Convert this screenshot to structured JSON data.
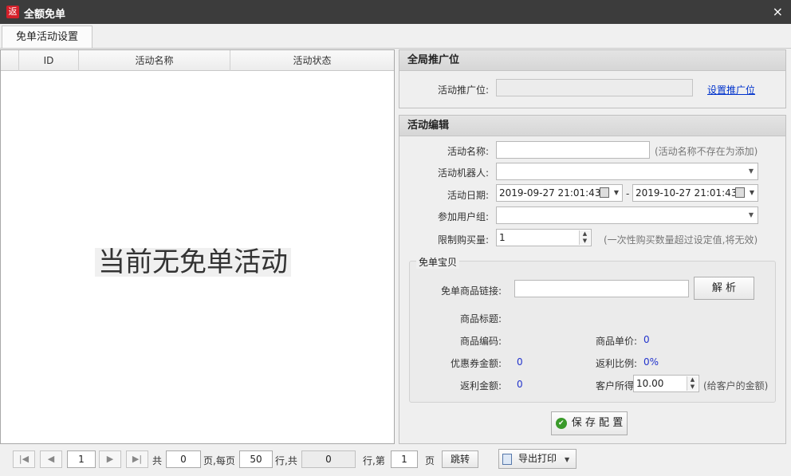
{
  "window": {
    "icon_text": "返",
    "title": "全额免单",
    "close": "×"
  },
  "tab": {
    "label": "免单活动设置"
  },
  "grid": {
    "columns": [
      "ID",
      "活动名称",
      "活动状态"
    ],
    "empty_text": "当前无免单活动"
  },
  "global_promo": {
    "header": "全局推广位",
    "field_label": "活动推广位:",
    "field_value": "",
    "link": "设置推广位"
  },
  "edit": {
    "header": "活动编辑",
    "name_label": "活动名称:",
    "name_value": "",
    "name_hint": "(活动名称不存在为添加)",
    "robot_label": "活动机器人:",
    "robot_value": "",
    "date_label": "活动日期:",
    "date_start": "2019-09-27 21:01:43",
    "date_sep": "-",
    "date_end": "2019-10-27 21:01:43",
    "group_label": "参加用户组:",
    "group_value": "",
    "limit_label": "限制购买量:",
    "limit_value": "1",
    "limit_hint": "(一次性购买数量超过设定值,将无效)"
  },
  "free_item": {
    "title": "免单宝贝",
    "link_label": "免单商品链接:",
    "link_value": "",
    "parse_button": "解 析",
    "goods_title_label": "商品标题:",
    "goods_code_label": "商品编码:",
    "unit_price_label": "商品单价:",
    "unit_price_value": "0",
    "coupon_label": "优惠券金额:",
    "coupon_value": "0",
    "rebate_ratio_label": "返利比例:",
    "rebate_ratio_value": "0%",
    "rebate_amount_label": "返利金额:",
    "rebate_amount_value": "0",
    "customer_label": "客户所得:",
    "customer_value": "10.00",
    "customer_hint": "(给客户的金额)"
  },
  "save_button": "保 存 配 置",
  "pager": {
    "page_value": "1",
    "total_prefix": "共",
    "total_pages": "0",
    "per_page_label": "页,每页",
    "per_page_value": "50",
    "rows_label": "行,共",
    "total_rows": "0",
    "goto_label": "行,第",
    "goto_page": "1",
    "page_suffix": "页",
    "jump_button": "跳转",
    "export_button": "导出打印"
  }
}
